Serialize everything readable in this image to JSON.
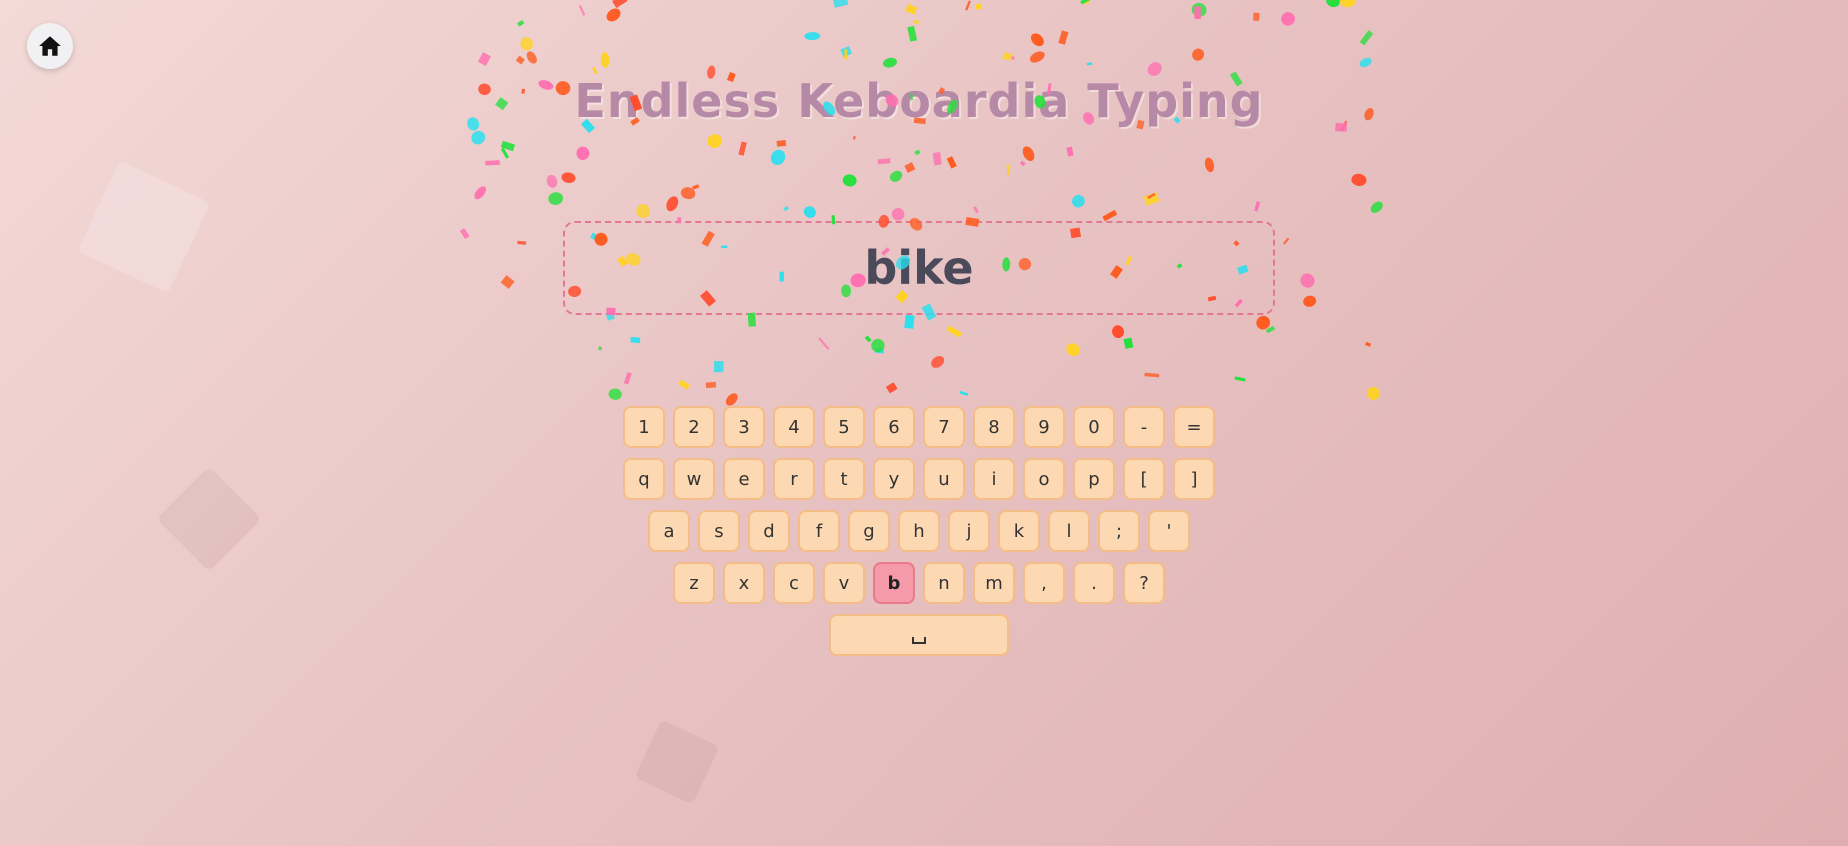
{
  "title": "Endless Keboardia Typing",
  "current_word": "bike",
  "active_key": "b",
  "home_icon": "home-icon",
  "colors": {
    "accent": "#e07a94",
    "key_bg": "#fcd9b3",
    "key_active": "#f49aa8",
    "title": "#b68aa6"
  },
  "keyboard": {
    "rows": [
      [
        "1",
        "2",
        "3",
        "4",
        "5",
        "6",
        "7",
        "8",
        "9",
        "0",
        "-",
        "="
      ],
      [
        "q",
        "w",
        "e",
        "r",
        "t",
        "y",
        "u",
        "i",
        "o",
        "p",
        "[",
        "]"
      ],
      [
        "a",
        "s",
        "d",
        "f",
        "g",
        "h",
        "j",
        "k",
        "l",
        ";",
        "'"
      ],
      [
        "z",
        "x",
        "c",
        "v",
        "b",
        "n",
        "m",
        ",",
        ".",
        "?"
      ]
    ]
  }
}
